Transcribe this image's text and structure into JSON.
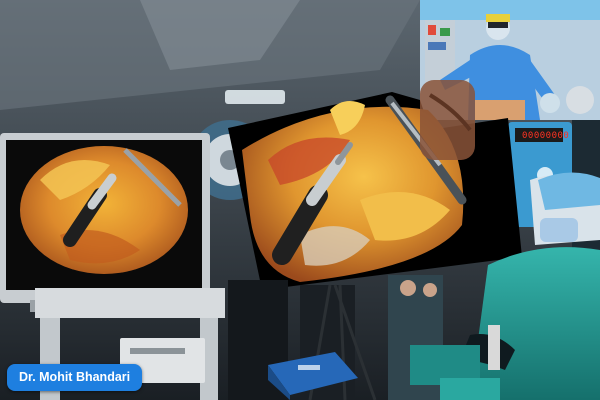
{
  "overlay": {
    "name_badge": "Dr. Mohit Bhandari",
    "device_display": "00000000"
  },
  "colors": {
    "badge_bg": "#1e7fe0",
    "badge_text": "#ffffff",
    "scrub_teal": "#2aa8a0",
    "tissue_orange": "#d98a2e"
  }
}
